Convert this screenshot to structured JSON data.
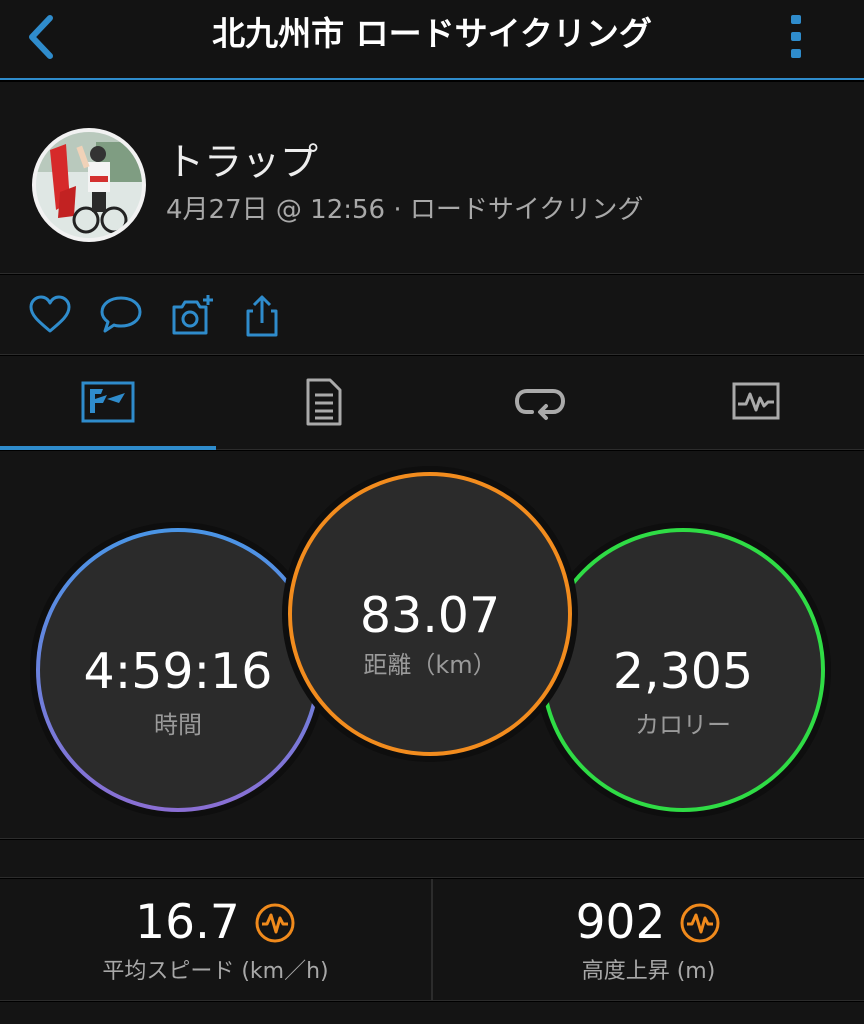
{
  "header": {
    "title": "北九州市 ロードサイクリング",
    "back_icon": "chevron-left-icon",
    "menu_icon": "more-vertical-icon"
  },
  "profile": {
    "name": "トラップ",
    "meta": "4月27日 @ 12:56 · ロードサイクリング"
  },
  "actions": [
    "heart-icon",
    "comment-icon",
    "add-photo-icon",
    "share-icon"
  ],
  "tabs": [
    {
      "icon": "stats-icon",
      "active": true
    },
    {
      "icon": "details-icon",
      "active": false
    },
    {
      "icon": "laps-icon",
      "active": false
    },
    {
      "icon": "chart-icon",
      "active": false
    }
  ],
  "summary": {
    "time": {
      "value": "4:59:16",
      "label": "時間"
    },
    "distance": {
      "value": "83.07",
      "label": "距離（km）"
    },
    "calories": {
      "value": "2,305",
      "label": "カロリー"
    }
  },
  "metrics": {
    "avg_speed": {
      "value": "16.7",
      "label": "平均スピード (km／h)"
    },
    "elevation_gain": {
      "value": "902",
      "label": "高度上昇 (m)"
    }
  },
  "colors": {
    "accent": "#2f8ccc",
    "time_ring_start": "#4a95e6",
    "time_ring_end": "#8a6fd4",
    "distance_ring": "#f28c1e",
    "calories_ring": "#2fdc45",
    "badge": "#f08a1c"
  }
}
